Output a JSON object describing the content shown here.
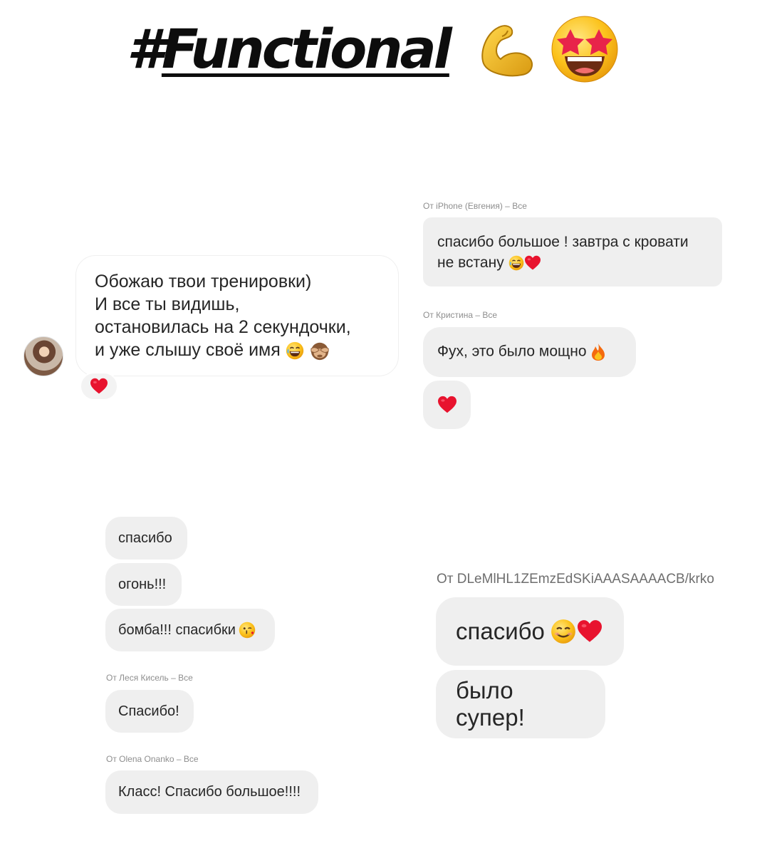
{
  "title": {
    "hash": "#",
    "word": "Functional",
    "emojis": [
      "flexed-biceps-emoji",
      "star-struck-emoji"
    ]
  },
  "left_thread": {
    "message": "Обожаю твои тренировки)\nИ все ты видишь,\nостановилась на 2 секундочки,\nи уже слышу своё имя",
    "emojis": [
      "laughing-emoji",
      "see-no-evil-monkey-emoji"
    ],
    "reaction": "heart"
  },
  "right_thread": {
    "sender1": "От iPhone (Евгения) – Все",
    "message1": "спасибо большое ! завтра с кровати\nне встану",
    "message1_emojis": [
      "sweat-smile-emoji",
      "heart"
    ],
    "sender2": "От Кристина – Все",
    "message2": "Фух, это было мощно",
    "message2_emoji": "fire-emoji",
    "message3": "heart"
  },
  "bottom_left": {
    "messages": [
      "спасибо",
      "огонь!!!",
      "бомба!!! спасибки"
    ],
    "bomba_emoji": "kissing-wink-emoji",
    "sender3": "От Леся Кисель – Все",
    "message_spasibo": "Спасибо!",
    "sender4": "От Olena Onanko – Все",
    "message_klass": "Класс! Спасибо большое!!!!"
  },
  "bottom_right": {
    "sender": "От DLeMlHL1ZEmzEdSKiAAASAAAACB/krko",
    "message1": "спасибо",
    "message1_emojis": [
      "smiling-emoji",
      "heart"
    ],
    "message2": "было супер!"
  },
  "colors": {
    "bubble": "#efefef",
    "heart": "#e8132e",
    "meta": "#8e8e8e",
    "text": "#262626"
  }
}
